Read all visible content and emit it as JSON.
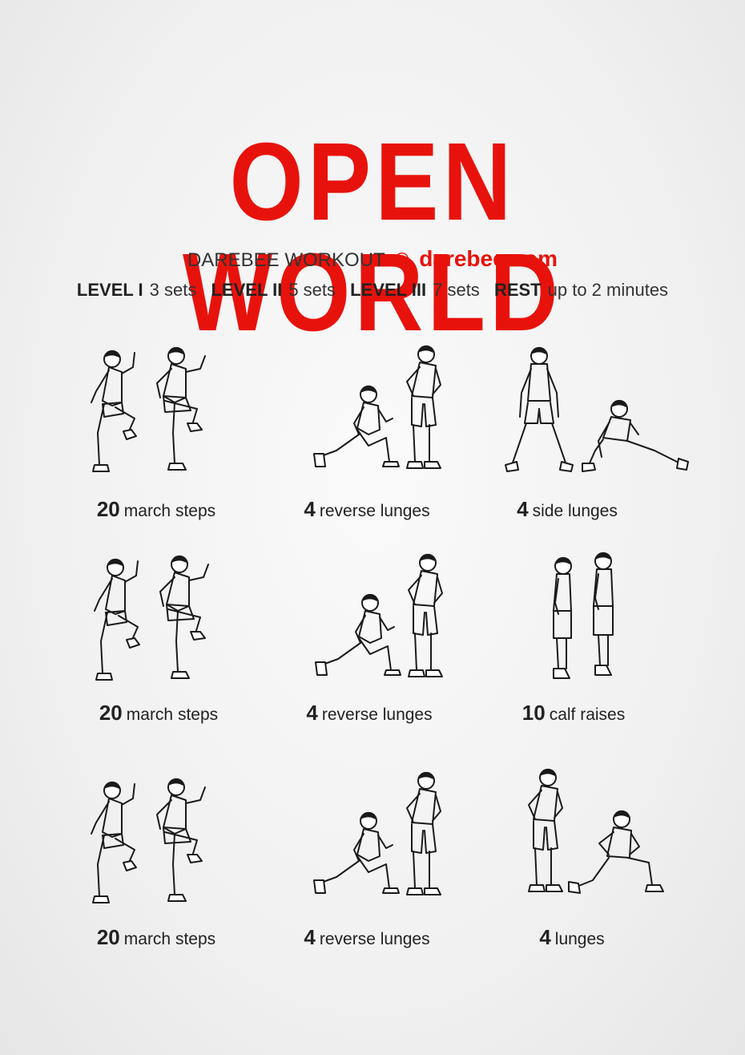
{
  "title": "OPEN WORLD",
  "header": {
    "workout_label": "DAREBEE WORKOUT",
    "copyright_symbol": "©",
    "site": "darebee.com"
  },
  "levels": {
    "level1_label": "LEVEL I",
    "level1_value": "3 sets",
    "level2_label": "LEVEL II",
    "level2_value": "5 sets",
    "level3_label": "LEVEL III",
    "level3_value": "7 sets",
    "rest_label": "REST",
    "rest_value": "up to 2 minutes"
  },
  "exercises": [
    {
      "count": "20",
      "name": "march steps",
      "icon": "march-steps-figure"
    },
    {
      "count": "4",
      "name": "reverse lunges",
      "icon": "reverse-lunges-figure"
    },
    {
      "count": "4",
      "name": "side lunges",
      "icon": "side-lunges-figure"
    },
    {
      "count": "20",
      "name": "march steps",
      "icon": "march-steps-figure"
    },
    {
      "count": "4",
      "name": "reverse lunges",
      "icon": "reverse-lunges-figure"
    },
    {
      "count": "10",
      "name": "calf raises",
      "icon": "calf-raises-figure"
    },
    {
      "count": "20",
      "name": "march steps",
      "icon": "march-steps-figure"
    },
    {
      "count": "4",
      "name": "reverse lunges",
      "icon": "reverse-lunges-figure"
    },
    {
      "count": "4",
      "name": "lunges",
      "icon": "lunges-figure"
    }
  ],
  "colors": {
    "accent": "#e8120c",
    "text": "#222222"
  }
}
